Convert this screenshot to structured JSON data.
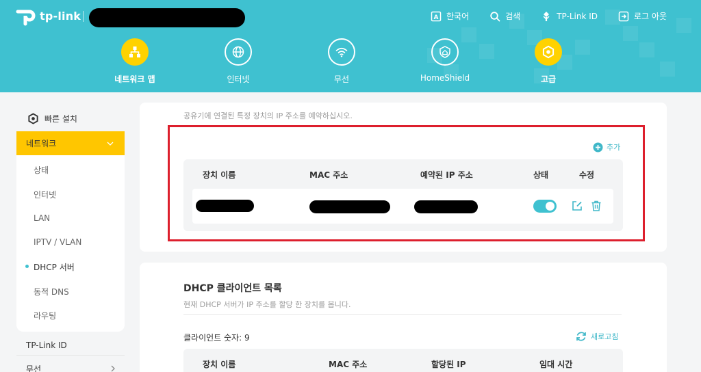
{
  "header": {
    "brand": "tp-link",
    "top_links": [
      {
        "label": "한국어",
        "icon": "language-icon"
      },
      {
        "label": "검색",
        "icon": "search-icon"
      },
      {
        "label": "TP-Link ID",
        "icon": "tplink-id-icon"
      },
      {
        "label": "로그 아웃",
        "icon": "logout-icon"
      }
    ],
    "nav": [
      {
        "label": "네트워크 맵",
        "icon": "network-map-icon",
        "active": true
      },
      {
        "label": "인터넷",
        "icon": "globe-icon",
        "active": false
      },
      {
        "label": "무선",
        "icon": "wifi-icon",
        "active": false
      },
      {
        "label": "HomeShield",
        "icon": "homeshield-icon",
        "active": false
      },
      {
        "label": "고급",
        "icon": "gear-icon",
        "active": true
      }
    ]
  },
  "sidebar": {
    "quick_setup": "빠른 설치",
    "network": "네트워크",
    "sub_items": [
      "상태",
      "인터넷",
      "LAN",
      "IPTV / VLAN",
      "DHCP 서버",
      "동적 DNS",
      "라우팅"
    ],
    "active_sub": "DHCP 서버",
    "items": [
      "TP-Link ID",
      "무선"
    ]
  },
  "reservation": {
    "description": "공유기에 연결된 특정 장치의 IP 주소를 예약하십시오.",
    "add_label": "추가",
    "columns": [
      "장치 이름",
      "MAC 주소",
      "예약된 IP 주소",
      "상태",
      "수정"
    ],
    "rows": [
      {
        "device_name": "[redacted]",
        "mac": "[redacted]",
        "ip": "[redacted]",
        "status": "on"
      }
    ]
  },
  "clients": {
    "title": "DHCP 클라이언트 목록",
    "description": "현재 DHCP 서버가 IP 주소를 할당 한 장치를 봅니다.",
    "count_label": "클라이언트 숫자: 9",
    "refresh_label": "새로고침",
    "columns": [
      "장치 이름",
      "MAC 주소",
      "할당된 IP",
      "임대 시간"
    ]
  },
  "colors": {
    "header_bg": "#3fc1d0",
    "accent_yellow": "#ffc600",
    "accent_teal": "#3fb7c8",
    "highlight_red": "#dd1f2d"
  }
}
